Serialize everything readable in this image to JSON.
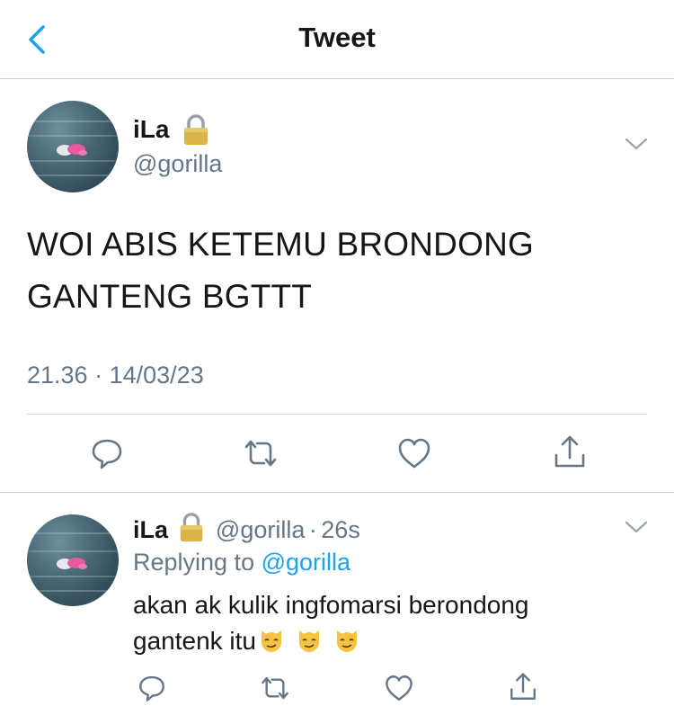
{
  "header": {
    "title": "Tweet",
    "back_icon": "chevron-left-icon"
  },
  "tweet": {
    "author_name": "iLa",
    "lock_icon": "lock-icon",
    "handle": "@gorilla",
    "text_line1": "WOI ABIS KETEMU BRONDONG",
    "text_line2": "GANTENG BGTTT",
    "time": "21.36",
    "separator": "·",
    "date": "14/03/23",
    "actions": [
      "reply-icon",
      "retweet-icon",
      "like-icon",
      "share-icon"
    ]
  },
  "reply": {
    "author_name": "iLa",
    "handle": "@gorilla",
    "separator": "·",
    "age": "26s",
    "replying_prefix": "Replying to",
    "replying_to": "@gorilla",
    "text_line1": "akan ak kulik ingfomarsi berondong",
    "text_line2": "gantenk itu",
    "emojis": [
      "smirk-cat-emoji",
      "smirk-cat-emoji",
      "smirk-cat-emoji"
    ],
    "actions": [
      "reply-icon",
      "retweet-icon",
      "like-icon",
      "share-icon"
    ]
  },
  "colors": {
    "accent": "#1da1f2",
    "secondary_text": "#657786",
    "primary_text": "#14171a",
    "divider": "#d6dadd"
  }
}
